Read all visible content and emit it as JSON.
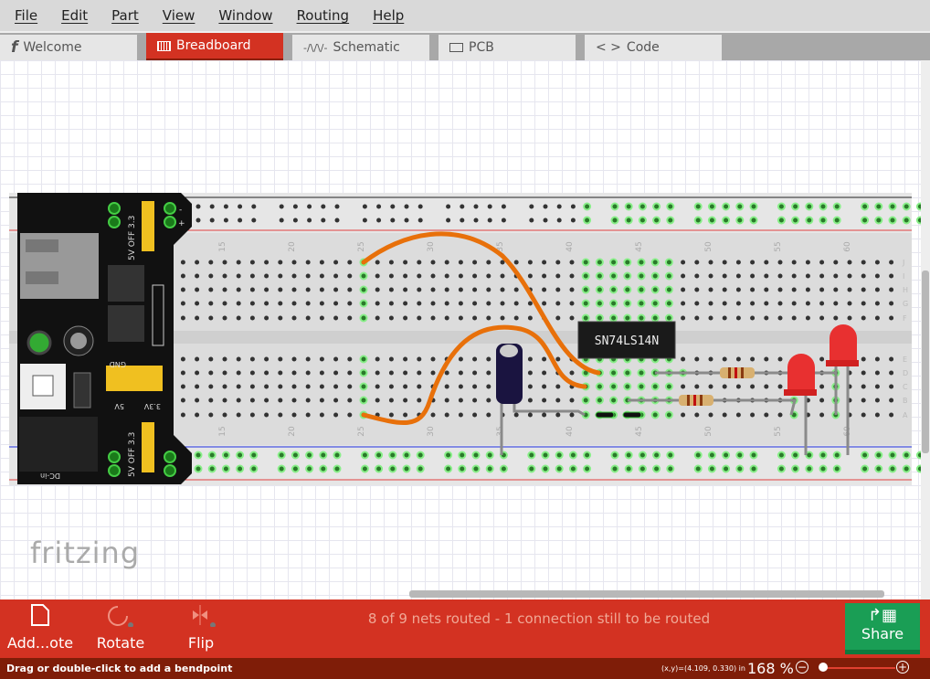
{
  "menu": [
    "File",
    "Edit",
    "Part",
    "View",
    "Window",
    "Routing",
    "Help"
  ],
  "tabs": [
    {
      "label": "Welcome",
      "icon": "fritzing-f-icon"
    },
    {
      "label": "Breadboard",
      "icon": "breadboard-icon",
      "active": true
    },
    {
      "label": "Schematic",
      "icon": "resistor-symbol-icon"
    },
    {
      "label": "PCB",
      "icon": "pcb-icon"
    },
    {
      "label": "Code",
      "icon": "code-brackets-icon"
    }
  ],
  "canvas": {
    "logo": "fritzing",
    "ic_label": "SN74LS14N",
    "column_labels": [
      "15",
      "20",
      "25",
      "30",
      "35",
      "40",
      "45",
      "50",
      "55",
      "60"
    ],
    "row_labels_top": [
      "J",
      "I",
      "H",
      "G",
      "F"
    ],
    "row_labels_bottom": [
      "E",
      "D",
      "C",
      "B",
      "A"
    ],
    "power_module": {
      "top_jumper": "5V OFF 3.3",
      "bottom_jumper": "5V OFF 3.3",
      "gnd": "GND",
      "v5": "5V",
      "v33": "3.3V",
      "dcin": "DC-in",
      "rail_minus": "-",
      "rail_plus": "+"
    }
  },
  "toolbar": {
    "add_note": "Add...ote",
    "rotate": "Rotate",
    "flip": "Flip",
    "share": "Share",
    "routing_status": "8 of 9 nets routed - 1 connection still to be routed"
  },
  "status": {
    "message": "Drag or double-click to add a bendpoint",
    "coords": "(x,y)=(4.109, 0.330) in",
    "zoom": "168 %",
    "zoom_out": "−",
    "zoom_in": "+"
  },
  "colors": {
    "accent": "#d33222",
    "share": "#1a9e55",
    "wire": "#e8700a",
    "statusbar": "#7f1d08"
  }
}
